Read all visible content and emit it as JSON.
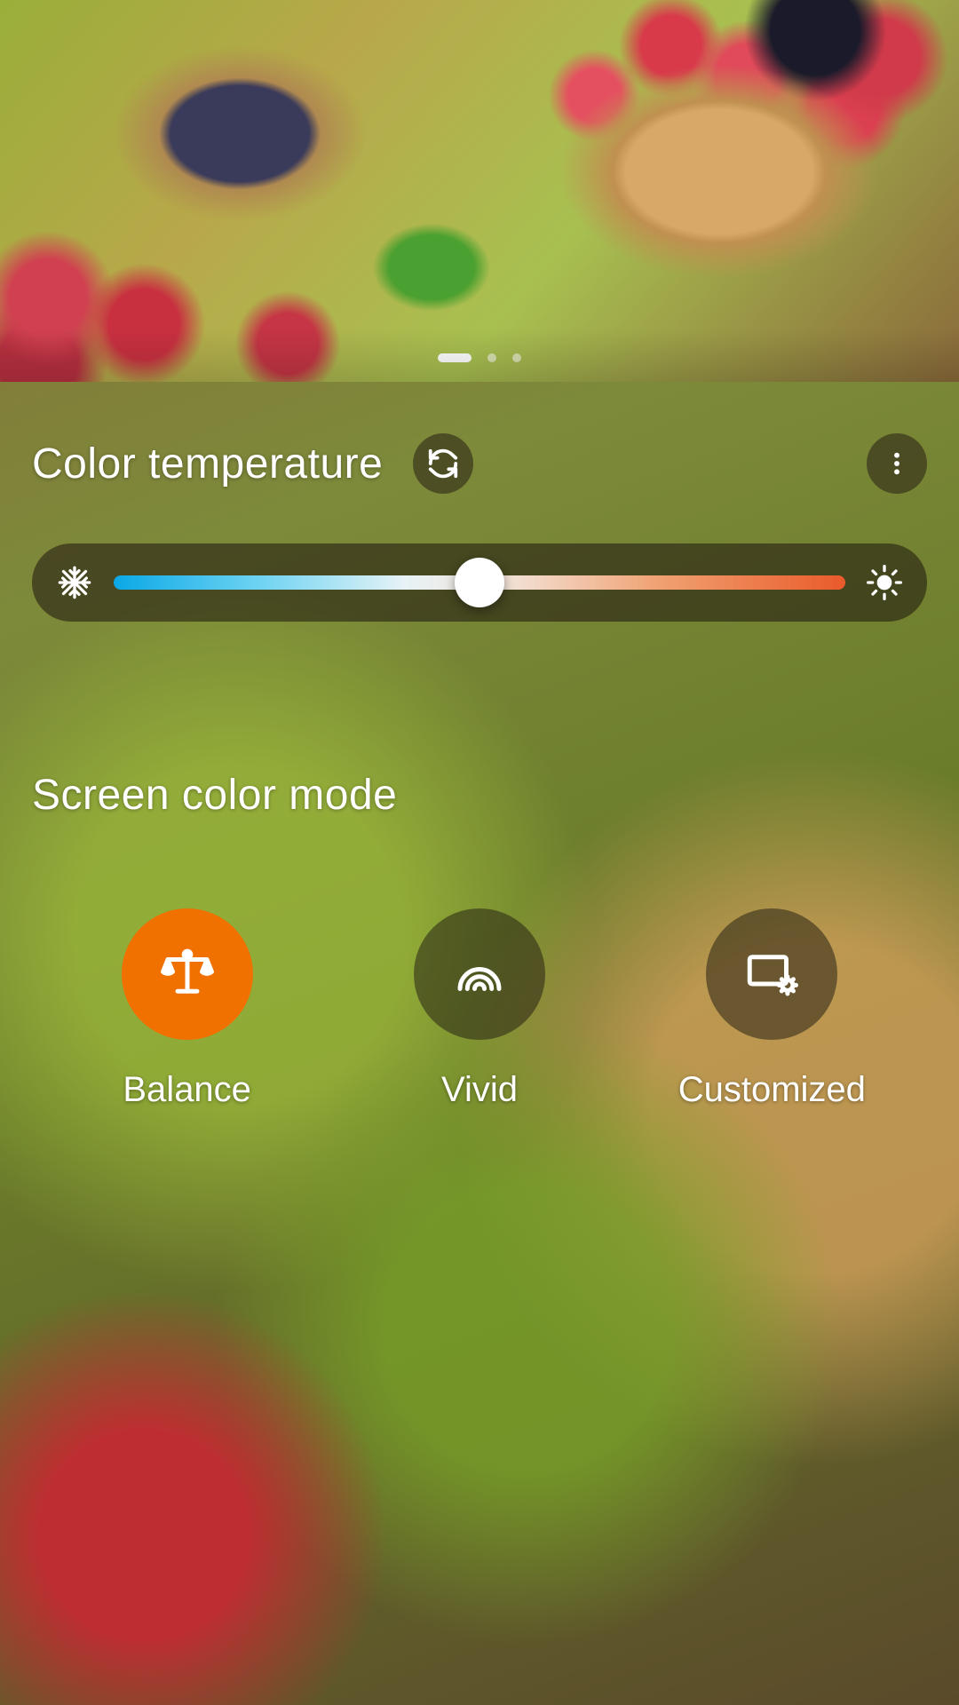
{
  "hero": {
    "pager": {
      "count": 3,
      "active_index": 0
    }
  },
  "color_temperature": {
    "title": "Color temperature",
    "slider_value_percent": 50
  },
  "screen_color_mode": {
    "title": "Screen color mode",
    "active_index": 0,
    "modes": [
      {
        "label": "Balance",
        "icon": "scale-icon"
      },
      {
        "label": "Vivid",
        "icon": "rainbow-icon"
      },
      {
        "label": "Customized",
        "icon": "screen-gear-icon"
      }
    ]
  },
  "colors": {
    "accent": "#f07000"
  }
}
